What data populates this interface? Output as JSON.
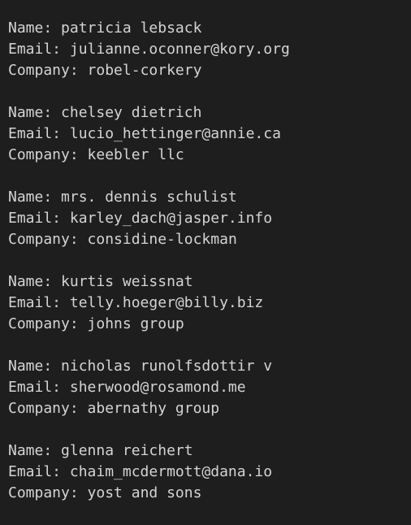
{
  "records": [
    {
      "name": "patricia lebsack",
      "email": "julianne.oconner@kory.org",
      "company": "robel-corkery"
    },
    {
      "name": "chelsey dietrich",
      "email": "lucio_hettinger@annie.ca",
      "company": "keebler llc"
    },
    {
      "name": "mrs. dennis schulist",
      "email": "karley_dach@jasper.info",
      "company": "considine-lockman"
    },
    {
      "name": "kurtis weissnat",
      "email": "telly.hoeger@billy.biz",
      "company": "johns group"
    },
    {
      "name": "nicholas runolfsdottir v",
      "email": "sherwood@rosamond.me",
      "company": "abernathy group"
    },
    {
      "name": "glenna reichert",
      "email": "chaim_mcdermott@dana.io",
      "company": "yost and sons"
    }
  ],
  "labels": {
    "name": "Name: ",
    "email": "Email: ",
    "company": "Company: "
  },
  "colors": {
    "background": "#1e1e1e",
    "text": "#d4d4d4"
  }
}
